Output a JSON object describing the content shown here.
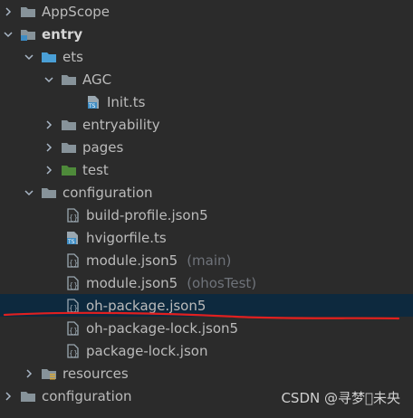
{
  "tree": {
    "appscope": "AppScope",
    "entry": "entry",
    "ets": "ets",
    "agc": "AGC",
    "init_ts": "Init.ts",
    "entryability": "entryability",
    "pages": "pages",
    "test": "test",
    "configuration": "configuration",
    "build_profile": "build-profile.json5",
    "hvigorfile": "hvigorfile.ts",
    "module_main": "module.json5",
    "module_main_tag": "(main)",
    "module_test": "module.json5",
    "module_test_tag": "(ohosTest)",
    "oh_package": "oh-package.json5",
    "oh_package_lock": "oh-package-lock.json5",
    "package_lock": "package-lock.json",
    "resources": "resources",
    "configuration_root": "configuration"
  },
  "watermark": "CSDN @寻梦\u0000未央",
  "colors": {
    "background": "#2b2b2b",
    "selection": "#0d293e",
    "folder": "#87939a",
    "module_folder": "#3d8cc4",
    "source_folder": "#4a9fd6",
    "test_folder": "#4e8a3a",
    "annotation_line": "#e02020"
  }
}
